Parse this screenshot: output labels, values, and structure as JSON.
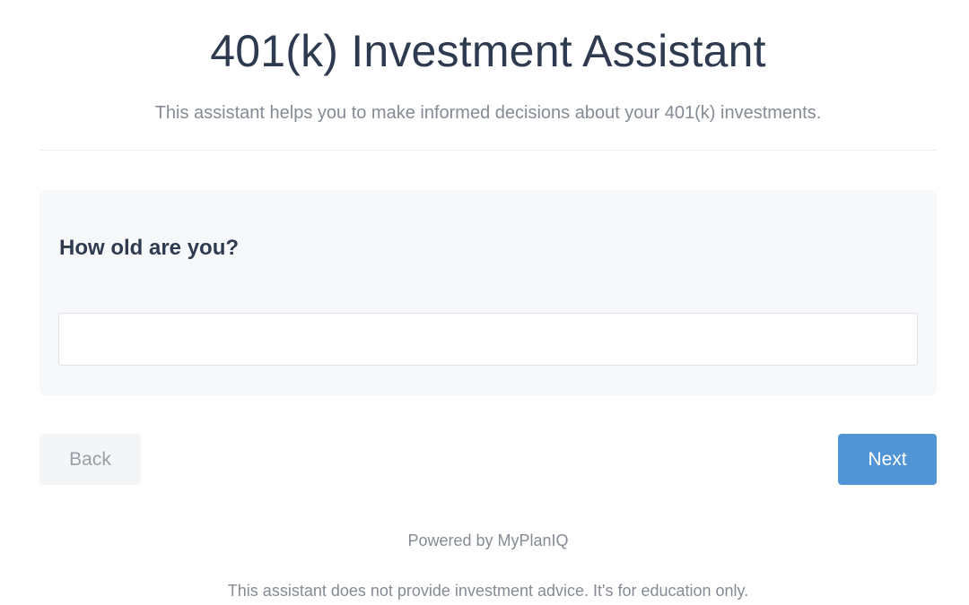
{
  "header": {
    "title": "401(k) Investment Assistant",
    "subtitle": "This assistant helps you to make informed decisions about your 401(k) investments."
  },
  "question": {
    "label": "How old are you?",
    "answer_value": "",
    "answer_placeholder": ""
  },
  "navigation": {
    "back_label": "Back",
    "next_label": "Next"
  },
  "footer": {
    "powered_by": "Powered by MyPlanIQ",
    "disclaimer": "This assistant does not provide investment advice. It's for education only."
  },
  "colors": {
    "title_text": "#2d3a4f",
    "muted_text": "#858b94",
    "card_background": "#f7f8f9",
    "primary_button": "#5195d6",
    "secondary_button": "#f3f5f7"
  }
}
